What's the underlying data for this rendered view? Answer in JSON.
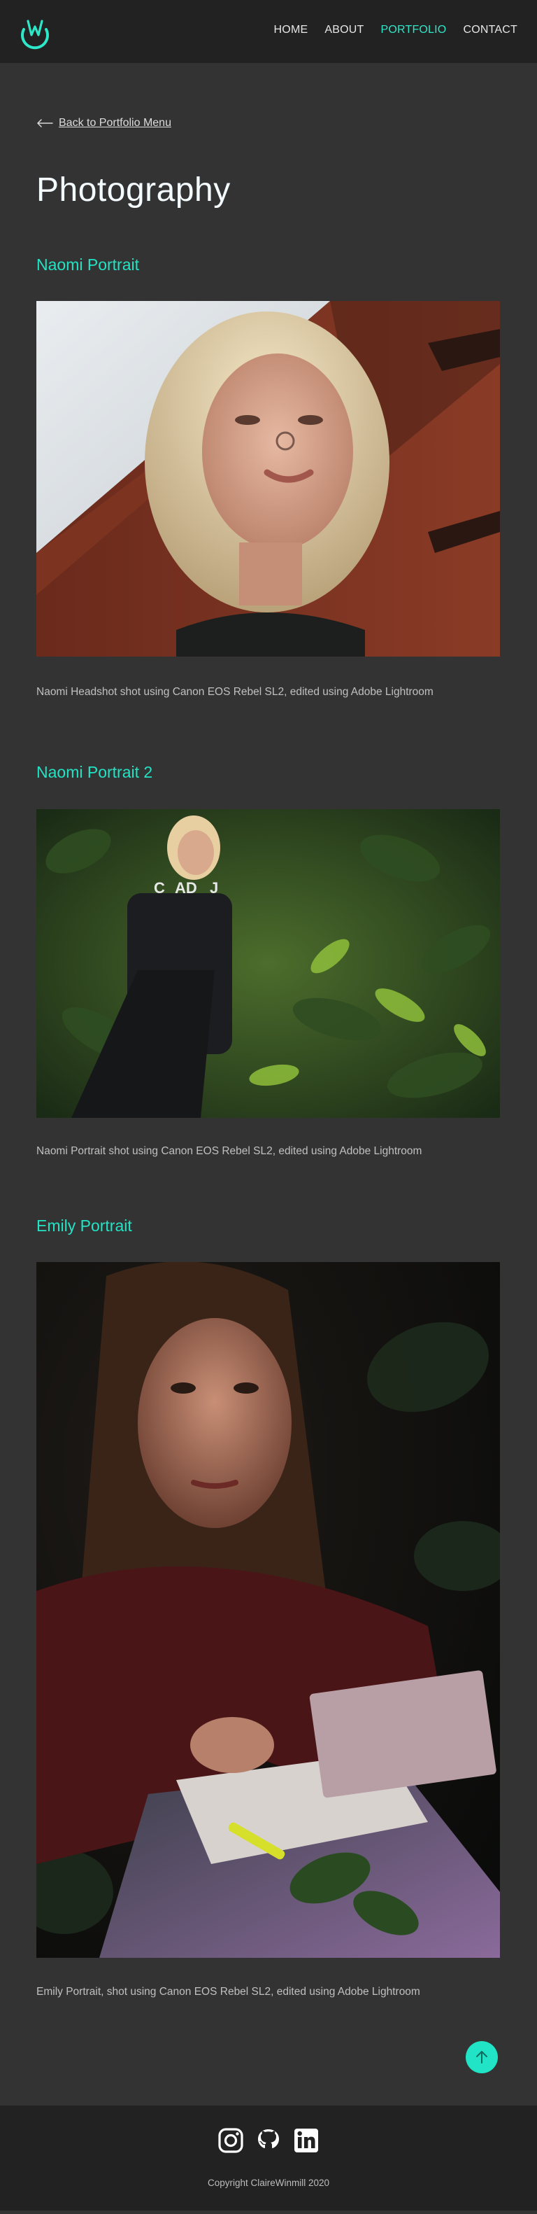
{
  "nav": {
    "logo_icon": "crescent-w-logo-icon",
    "accent_color": "#2ee6c8",
    "links": [
      {
        "label": "HOME"
      },
      {
        "label": "ABOUT"
      },
      {
        "label": "PORTFOLIO",
        "active": true
      },
      {
        "label": "CONTACT"
      }
    ]
  },
  "back_link": {
    "label": "Back to Portfolio Menu",
    "icon": "arrow-left-icon"
  },
  "page_title": "Photography",
  "sections": [
    {
      "title": "Naomi Portrait",
      "caption": "Naomi Headshot shot using Canon EOS Rebel SL2, edited using Adobe Lightroom"
    },
    {
      "title": "Naomi Portrait 2",
      "caption": "Naomi Portrait shot using Canon EOS Rebel SL2, edited using Adobe Lightroom"
    },
    {
      "title": "Emily Portrait",
      "caption": "Emily Portrait, shot using Canon EOS Rebel SL2, edited using Adobe Lightroom"
    }
  ],
  "scroll_top": {
    "icon": "arrow-up-icon",
    "color": "#20e4c5"
  },
  "footer": {
    "social_icons": [
      "instagram-icon",
      "github-icon",
      "linkedin-icon"
    ],
    "copyright": "Copyright ClaireWinmill 2020"
  }
}
